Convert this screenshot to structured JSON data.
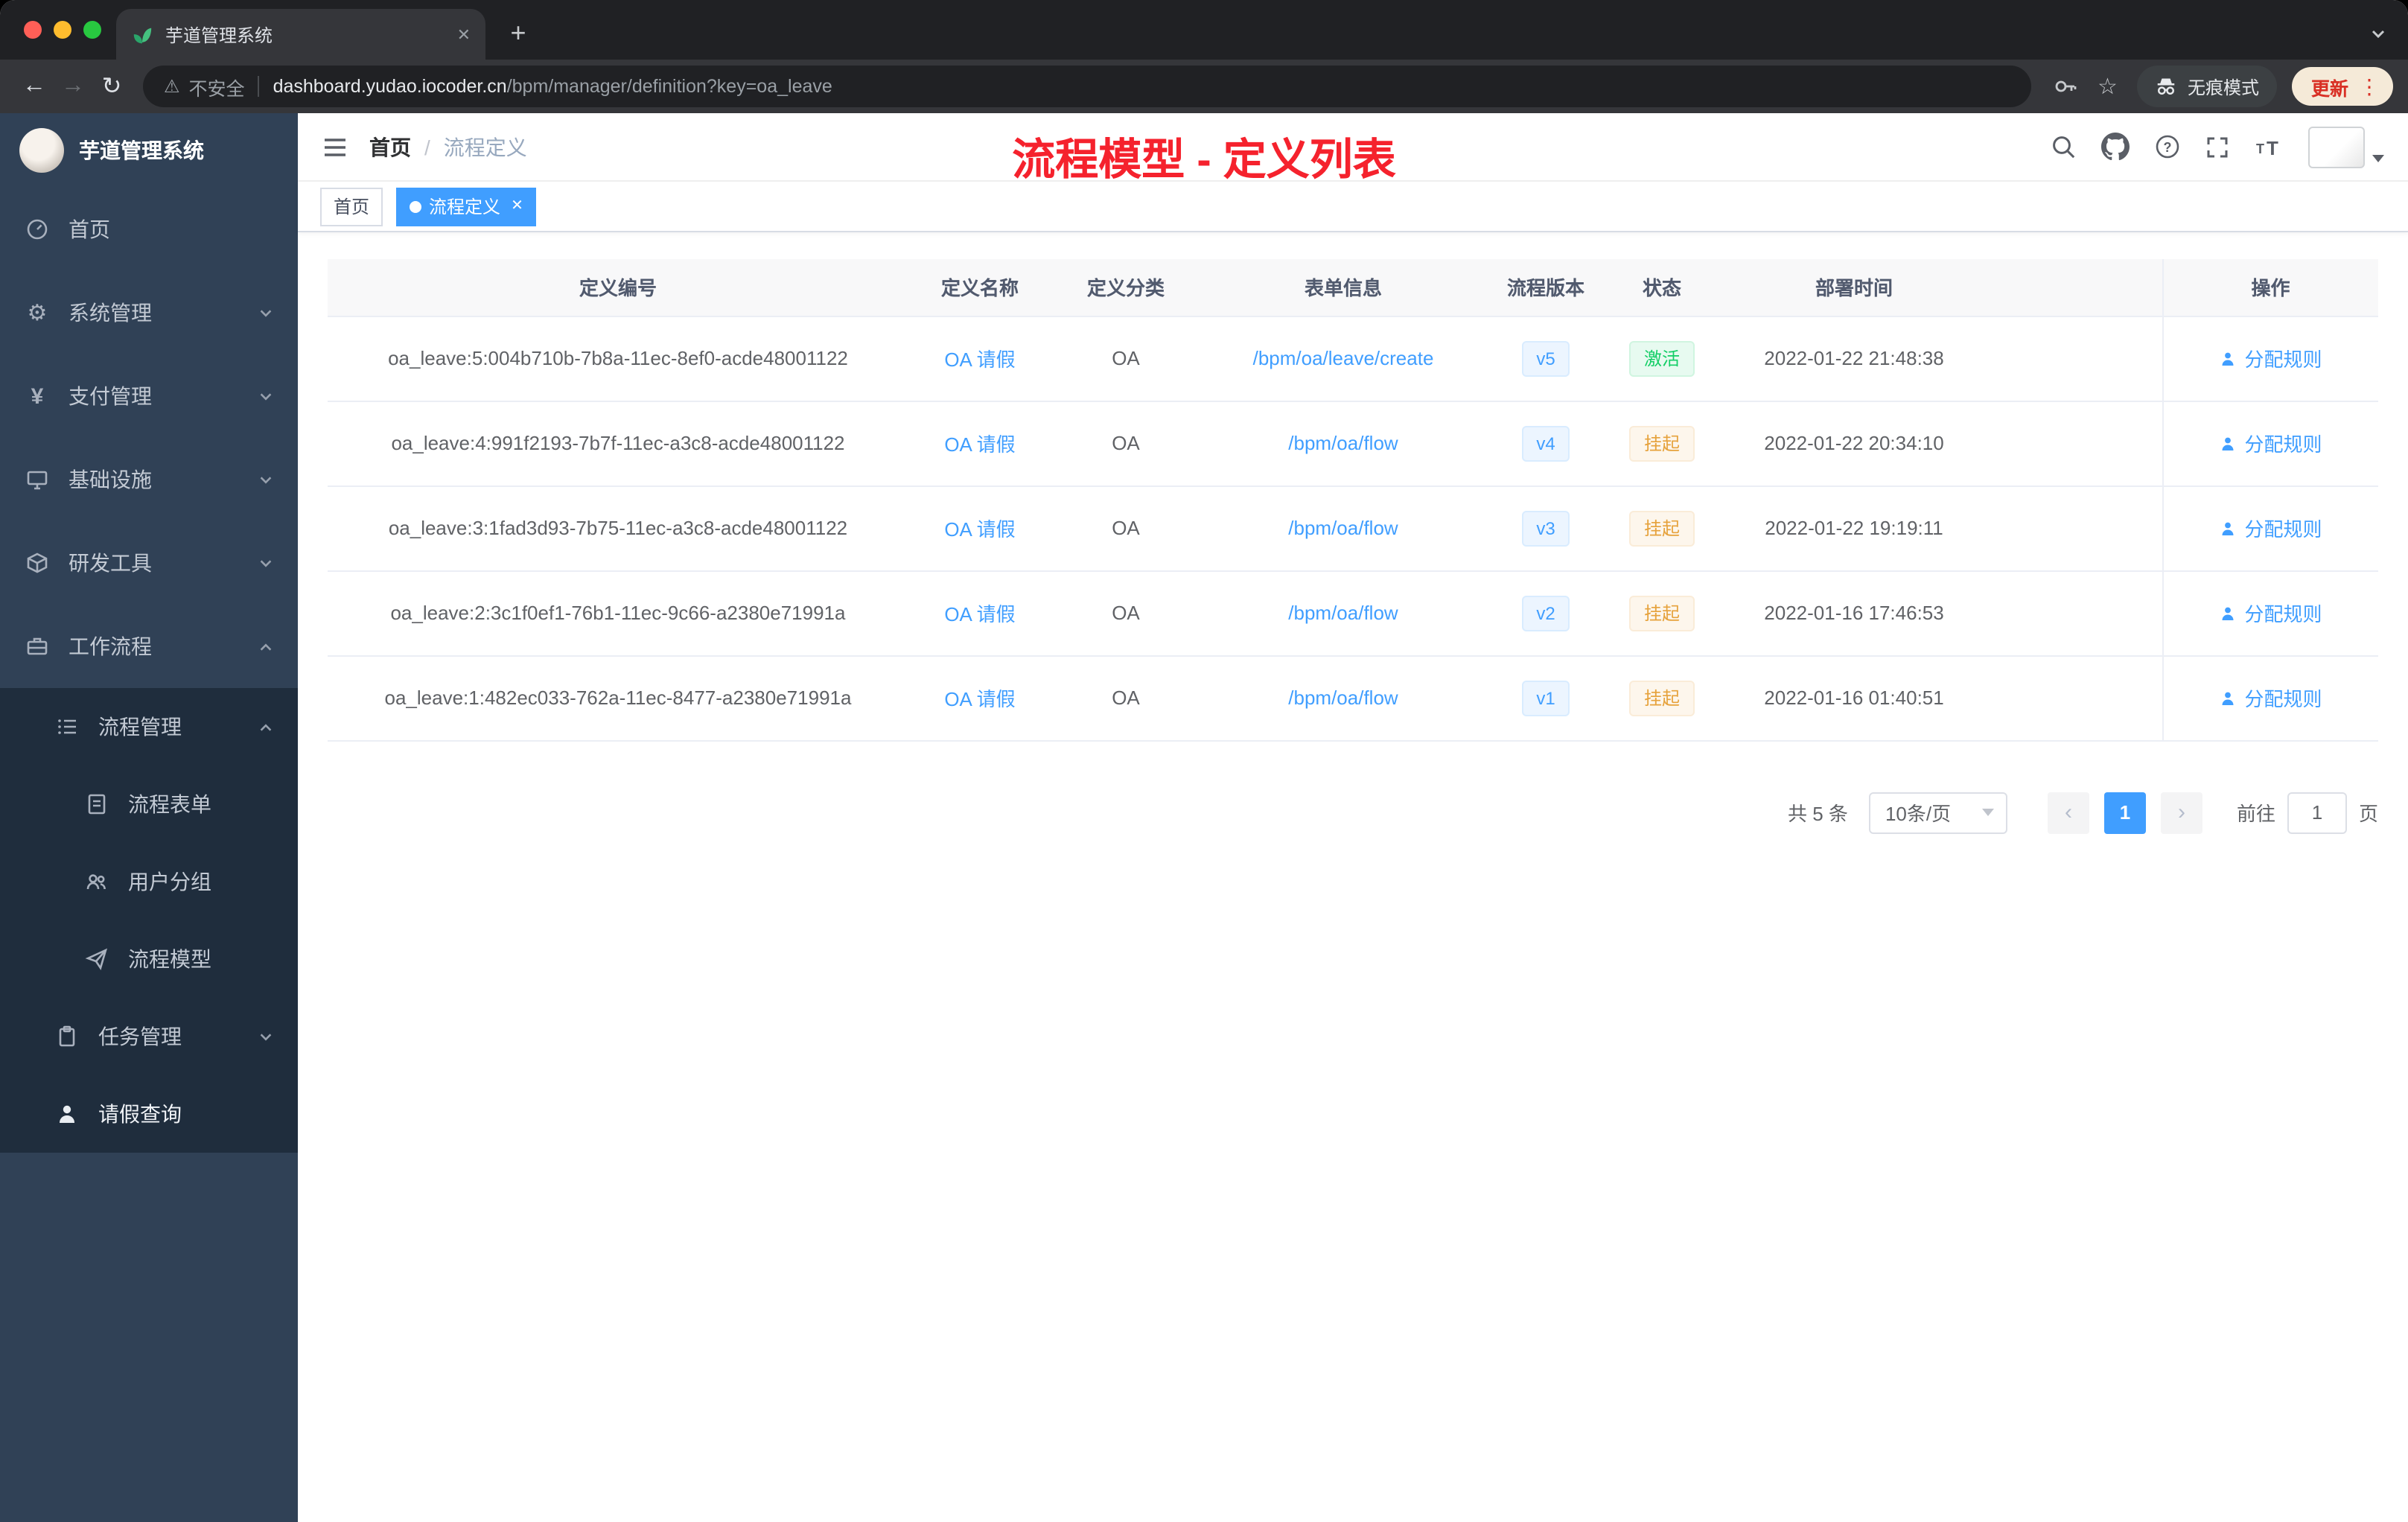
{
  "colors": {
    "accent": "#409eff",
    "annotation_red": "#f5222d",
    "status_active_green": "#13ce66",
    "status_suspend_orange": "#e6a23c",
    "sidebar_bg": "#304156",
    "submenu_bg": "#1f2d3d"
  },
  "icons": {
    "back": "←",
    "forward": "→",
    "reload": "↻",
    "warning": "⚠",
    "star": "☆",
    "plus": "+",
    "close": "✕",
    "dots": "⋮",
    "gear": "⚙",
    "yen": "¥",
    "prev": "‹",
    "next": "›"
  },
  "browser": {
    "tab_title": "芋道管理系统",
    "security_label": "不安全",
    "url_host": "dashboard.yudao.iocoder.cn",
    "url_path": "/bpm/manager/definition?key=oa_leave",
    "incognito_label": "无痕模式",
    "update_label": "更新"
  },
  "sidebar": {
    "title": "芋道管理系统",
    "menu": [
      {
        "label": "首页"
      },
      {
        "label": "系统管理"
      },
      {
        "label": "支付管理"
      },
      {
        "label": "基础设施"
      },
      {
        "label": "研发工具"
      },
      {
        "label": "工作流程"
      }
    ],
    "submenu": [
      {
        "label": "流程管理"
      },
      {
        "label": "流程表单"
      },
      {
        "label": "用户分组"
      },
      {
        "label": "流程模型"
      },
      {
        "label": "任务管理"
      },
      {
        "label": "请假查询"
      }
    ]
  },
  "navbar": {
    "breadcrumb_home": "首页",
    "breadcrumb_sep": "/",
    "breadcrumb_current": "流程定义",
    "annotation": "流程模型 - 定义列表"
  },
  "tags": {
    "home": "首页",
    "active": "流程定义"
  },
  "table": {
    "headers": [
      "定义编号",
      "定义名称",
      "定义分类",
      "表单信息",
      "流程版本",
      "状态",
      "部署时间",
      "操作"
    ],
    "rows": [
      {
        "id": "oa_leave:5:004b710b-7b8a-11ec-8ef0-acde48001122",
        "name": "OA 请假",
        "category": "OA",
        "form": "/bpm/oa/leave/create",
        "version": "v5",
        "status": "激活",
        "status_type": "active",
        "time": "2022-01-22 21:48:38",
        "action": "分配规则"
      },
      {
        "id": "oa_leave:4:991f2193-7b7f-11ec-a3c8-acde48001122",
        "name": "OA 请假",
        "category": "OA",
        "form": "/bpm/oa/flow",
        "version": "v4",
        "status": "挂起",
        "status_type": "suspend",
        "time": "2022-01-22 20:34:10",
        "action": "分配规则"
      },
      {
        "id": "oa_leave:3:1fad3d93-7b75-11ec-a3c8-acde48001122",
        "name": "OA 请假",
        "category": "OA",
        "form": "/bpm/oa/flow",
        "version": "v3",
        "status": "挂起",
        "status_type": "suspend",
        "time": "2022-01-22 19:19:11",
        "action": "分配规则"
      },
      {
        "id": "oa_leave:2:3c1f0ef1-76b1-11ec-9c66-a2380e71991a",
        "name": "OA 请假",
        "category": "OA",
        "form": "/bpm/oa/flow",
        "version": "v2",
        "status": "挂起",
        "status_type": "suspend",
        "time": "2022-01-16 17:46:53",
        "action": "分配规则"
      },
      {
        "id": "oa_leave:1:482ec033-762a-11ec-8477-a2380e71991a",
        "name": "OA 请假",
        "category": "OA",
        "form": "/bpm/oa/flow",
        "version": "v1",
        "status": "挂起",
        "status_type": "suspend",
        "time": "2022-01-16 01:40:51",
        "action": "分配规则"
      }
    ]
  },
  "pagination": {
    "total": "共 5 条",
    "page_size": "10条/页",
    "page": "1",
    "goto": "前往",
    "goto_value": "1",
    "unit": "页"
  }
}
